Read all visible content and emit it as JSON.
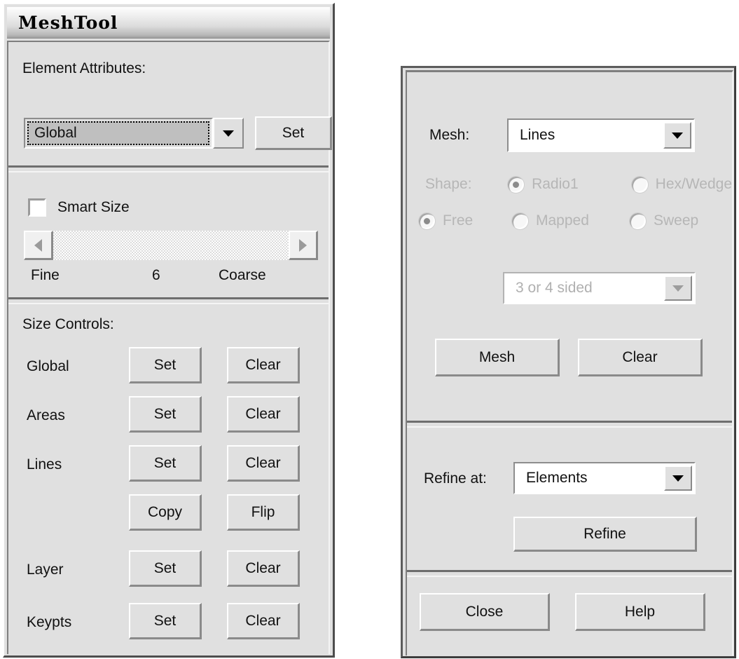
{
  "window": {
    "title": "MeshTool"
  },
  "element_attributes": {
    "label": "Element Attributes:",
    "selected": "Global",
    "set_label": "Set",
    "dropdown_icon": "chevron-down-icon"
  },
  "smart_size": {
    "checkbox_label": "Smart Size",
    "checked": false,
    "left_arrow_icon": "triangle-left-icon",
    "right_arrow_icon": "triangle-right-icon",
    "fine_label": "Fine",
    "value_label": "6",
    "coarse_label": "Coarse"
  },
  "size_controls": {
    "heading": "Size Controls:",
    "rows": [
      {
        "label": "Global",
        "buttons": [
          "Set",
          "Clear"
        ]
      },
      {
        "label": "Areas",
        "buttons": [
          "Set",
          "Clear"
        ]
      },
      {
        "label": "Lines",
        "buttons": [
          "Set",
          "Clear"
        ]
      },
      {
        "label": "",
        "buttons": [
          "Copy",
          "Flip"
        ]
      },
      {
        "label": "Layer",
        "buttons": [
          "Set",
          "Clear"
        ]
      },
      {
        "label": "Keypts",
        "buttons": [
          "Set",
          "Clear"
        ]
      }
    ]
  },
  "mesh_section": {
    "mesh_label": "Mesh:",
    "mesh_value": "Lines",
    "shape_label": "Shape:",
    "shape_options": [
      {
        "label": "Radio1",
        "selected": true,
        "disabled": true
      },
      {
        "label": "Hex/Wedge",
        "selected": false,
        "disabled": true
      }
    ],
    "method_options": [
      {
        "label": "Free",
        "selected": true,
        "disabled": true
      },
      {
        "label": "Mapped",
        "selected": false,
        "disabled": true
      },
      {
        "label": "Sweep",
        "selected": false,
        "disabled": true
      }
    ],
    "sided_value": "3 or 4 sided",
    "sided_disabled": true,
    "mesh_button": "Mesh",
    "clear_button": "Clear"
  },
  "refine_section": {
    "label": "Refine at:",
    "value": "Elements",
    "refine_button": "Refine"
  },
  "footer": {
    "close_button": "Close",
    "help_button": "Help"
  },
  "colors": {
    "face": "#e0e0e0",
    "shadow": "#7f7f7f",
    "highlight": "#ffffff",
    "text": "#111111",
    "disabled_text": "#b6b6b6",
    "combo_field": "#ffffff",
    "focus_field": "#bfbfbf"
  }
}
